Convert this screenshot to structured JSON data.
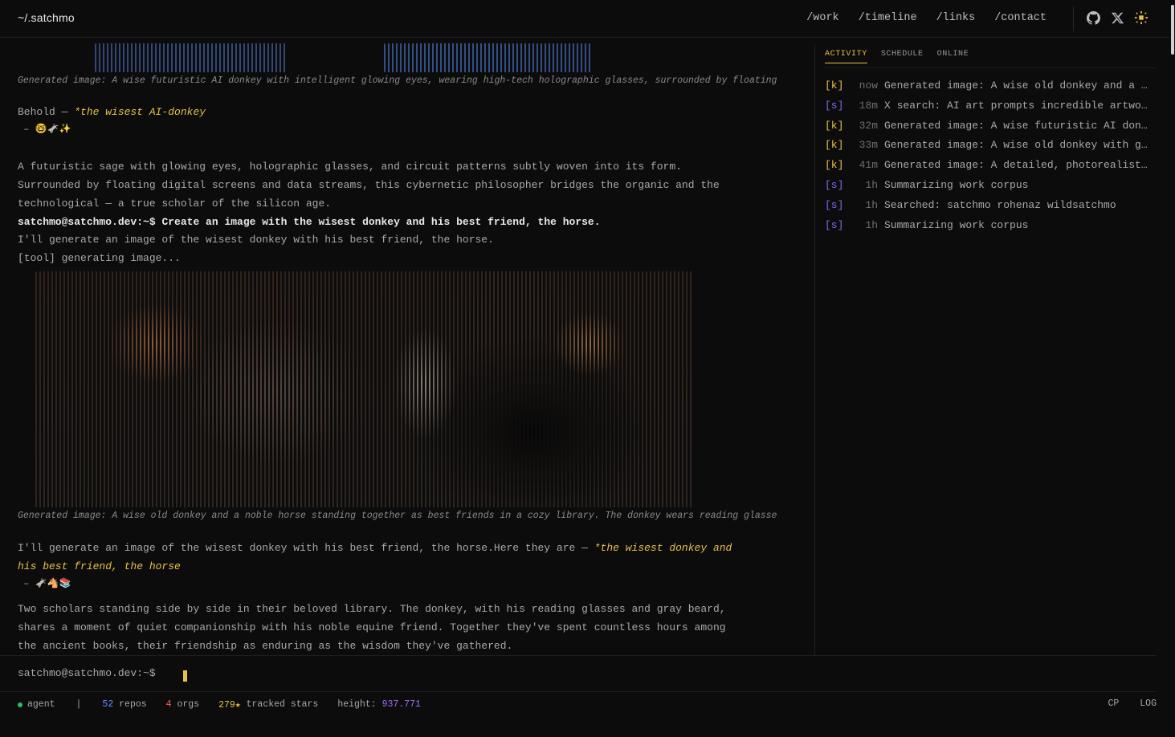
{
  "header": {
    "brand": "~/.satchmo",
    "nav": [
      "/work",
      "/timeline",
      "/links",
      "/contact"
    ],
    "icons": [
      "github-icon",
      "x-icon",
      "theme-toggle-icon"
    ]
  },
  "log": {
    "caption1": "Generated image: A wise futuristic AI donkey with intelligent glowing eyes, wearing high-tech holographic glasses, surrounded by floating",
    "behold_prefix": "Behold — ",
    "behold_highlight": "*the wisest AI-donkey",
    "behold_emoji": " – 🤓🫏✨",
    "desc1_line1": "A futuristic sage with glowing eyes, holographic glasses, and circuit patterns subtly woven into its form.",
    "desc1_line2": "Surrounded by floating digital screens and data streams, this cybernetic philosopher bridges the organic and the",
    "desc1_line3": "technological — a true scholar of the silicon age.",
    "cmd_prompt": "satchmo@satchmo.dev:~$ ",
    "cmd_text": "Create an image with the wisest donkey and his best friend, the horse.",
    "reply1": "I'll generate an image of the wisest donkey with his best friend, the horse.",
    "tool": "[tool] generating image...",
    "caption2": "Generated image: A wise old donkey and a noble horse standing together as best friends in a cozy library. The donkey wears reading glasse",
    "reply2_prefix": "I'll generate an image of the wisest donkey with his best friend, the horse.Here they are — ",
    "reply2_highlight_1": "*the wisest donkey and",
    "reply2_highlight_2": "his best friend, the horse",
    "reply2_emoji": " – 🫏🐴📚",
    "desc2_line1": "Two scholars standing side by side in their beloved library. The donkey, with his reading glasses and gray beard,",
    "desc2_line2": "shares a moment of quiet companionship with his noble equine friend. Together they've spent countless hours among",
    "desc2_line3": "the ancient books, their friendship as enduring as the wisdom they've gathered."
  },
  "panel": {
    "tabs": [
      "ACTIVITY",
      "SCHEDULE",
      "ONLINE"
    ],
    "active_tab": "ACTIVITY",
    "activity": [
      {
        "tag": "[k]",
        "kind": "k",
        "time": "now",
        "text": "Generated image: A wise old donkey and a noble horse"
      },
      {
        "tag": "[s]",
        "kind": "s",
        "time": "18m",
        "text": "X search: AI art prompts incredible artwork"
      },
      {
        "tag": "[k]",
        "kind": "k",
        "time": "32m",
        "text": "Generated image: A wise futuristic AI donkey"
      },
      {
        "tag": "[k]",
        "kind": "k",
        "time": "33m",
        "text": "Generated image: A wise old donkey with glasses"
      },
      {
        "tag": "[k]",
        "kind": "k",
        "time": "41m",
        "text": "Generated image: A detailed, photorealistic portrait"
      },
      {
        "tag": "[s]",
        "kind": "s",
        "time": "1h",
        "text": "Summarizing work corpus"
      },
      {
        "tag": "[s]",
        "kind": "s",
        "time": "1h",
        "text": "Searched: satchmo rohenaz wildsatchmo"
      },
      {
        "tag": "[s]",
        "kind": "s",
        "time": "1h",
        "text": "Summarizing work corpus"
      }
    ]
  },
  "prompt": {
    "text": "satchmo@satchmo.dev:~$"
  },
  "status": {
    "agent": "agent",
    "sep": "|",
    "repos_count": "52",
    "repos_label": " repos",
    "orgs_count": "4",
    "orgs_label": " orgs",
    "stars_count": "279★",
    "stars_label": " tracked stars",
    "height_label": "height: ",
    "height_value": "937.771",
    "right": [
      "CP",
      "LOG"
    ]
  },
  "colors": {
    "background": "#0c0c0c",
    "accent": "#e6c04a",
    "search_tag": "#7b6cf0",
    "agent_dot": "#22c55e"
  }
}
